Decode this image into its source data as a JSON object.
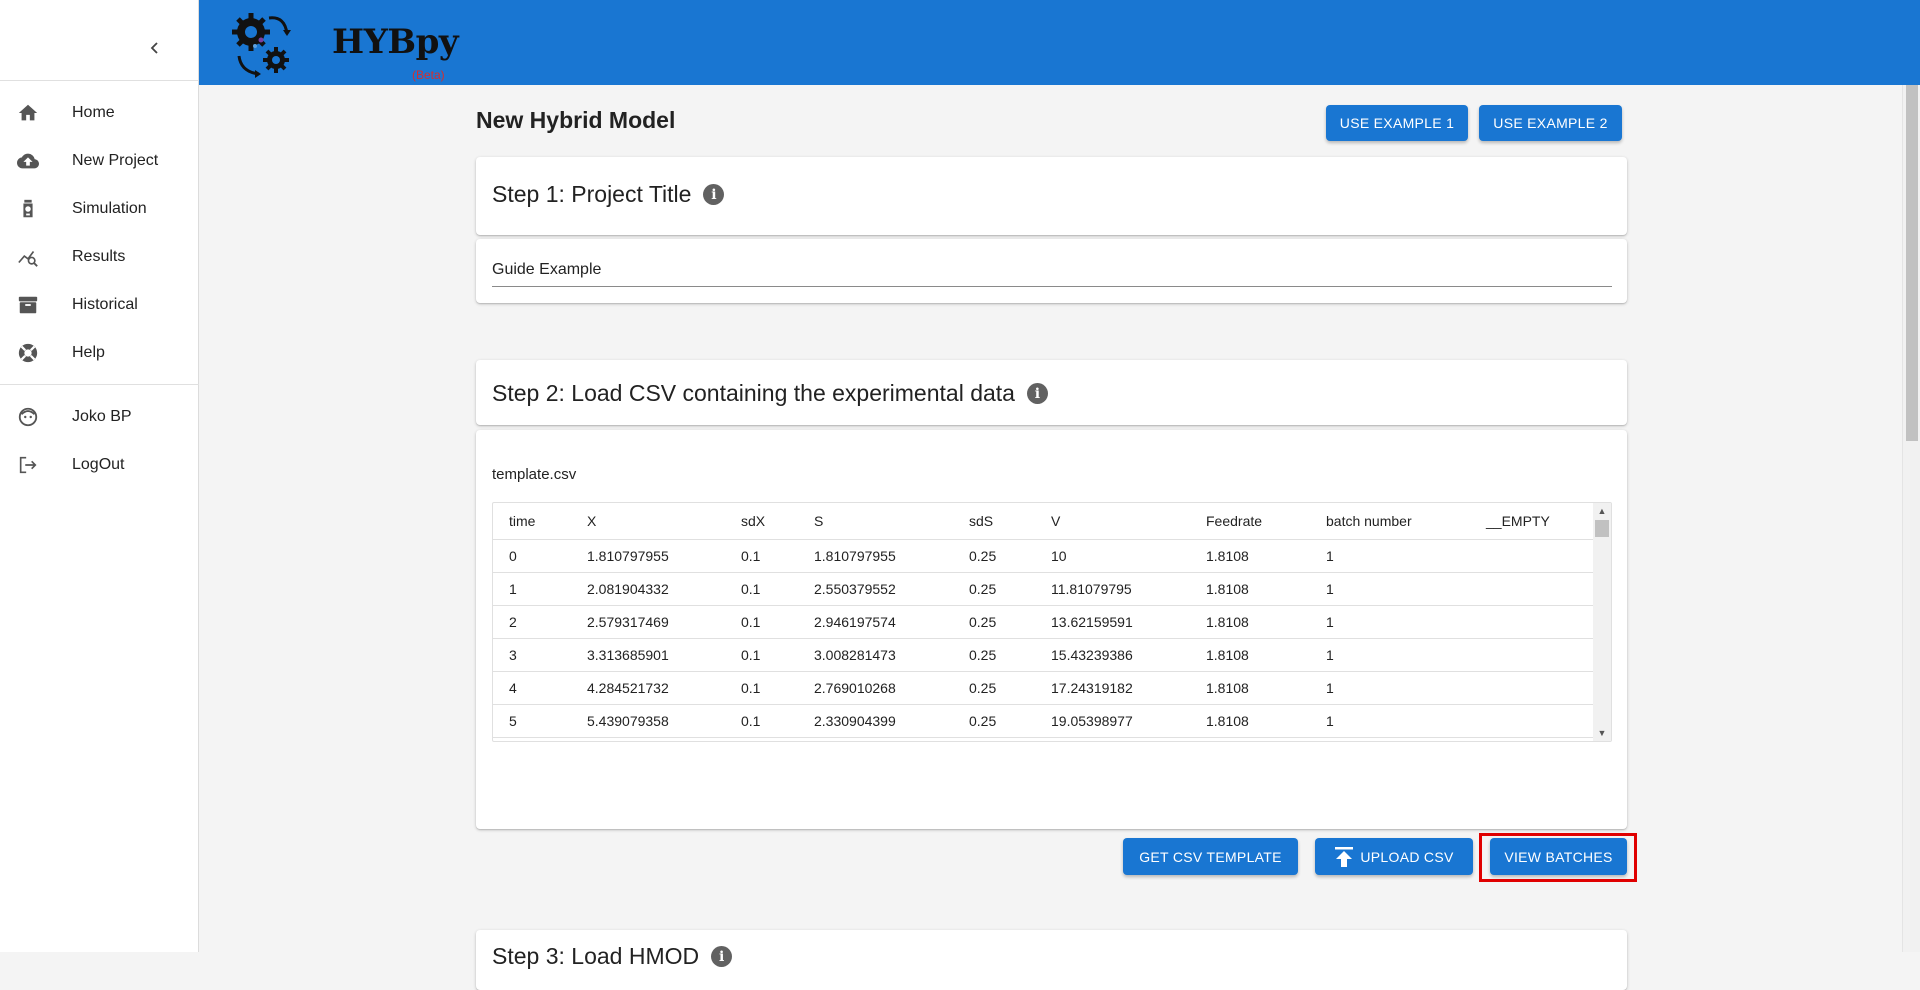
{
  "sidebar": {
    "collapse_icon": "chevron-left-icon",
    "items": [
      {
        "label": "Home",
        "icon": "home-icon"
      },
      {
        "label": "New Project",
        "icon": "cloud-upload-icon"
      },
      {
        "label": "Simulation",
        "icon": "simulation-icon"
      },
      {
        "label": "Results",
        "icon": "query-stats-icon"
      },
      {
        "label": "Historical",
        "icon": "archive-icon"
      },
      {
        "label": "Help",
        "icon": "lifebuoy-icon"
      }
    ],
    "user": {
      "label": "Joko BP",
      "icon": "face-icon"
    },
    "logout": {
      "label": "LogOut",
      "icon": "logout-icon"
    }
  },
  "header": {
    "logo_text": "HYBpy",
    "beta": "(Beta)",
    "color": "#1976d2"
  },
  "main": {
    "title": "New Hybrid Model",
    "example1": "USE EXAMPLE 1",
    "example2": "USE EXAMPLE 2",
    "step1": {
      "title": "Step 1: Project Title",
      "value": "Guide Example"
    },
    "step2": {
      "title": "Step 2: Load CSV containing the experimental data",
      "filename": "template.csv",
      "columns": [
        "time",
        "X",
        "sdX",
        "S",
        "sdS",
        "V",
        "Feedrate",
        "batch number",
        "__EMPTY"
      ],
      "rows": [
        [
          "0",
          "1.810797955",
          "0.1",
          "1.810797955",
          "0.25",
          "10",
          "1.8108",
          "1",
          ""
        ],
        [
          "1",
          "2.081904332",
          "0.1",
          "2.550379552",
          "0.25",
          "11.81079795",
          "1.8108",
          "1",
          ""
        ],
        [
          "2",
          "2.579317469",
          "0.1",
          "2.946197574",
          "0.25",
          "13.62159591",
          "1.8108",
          "1",
          ""
        ],
        [
          "3",
          "3.313685901",
          "0.1",
          "3.008281473",
          "0.25",
          "15.43239386",
          "1.8108",
          "1",
          ""
        ],
        [
          "4",
          "4.284521732",
          "0.1",
          "2.769010268",
          "0.25",
          "17.24319182",
          "1.8108",
          "1",
          ""
        ],
        [
          "5",
          "5.439079358",
          "0.1",
          "2.330904399",
          "0.25",
          "19.05398977",
          "1.8108",
          "1",
          ""
        ]
      ],
      "get_template": "GET CSV TEMPLATE",
      "upload": "UPLOAD CSV",
      "view_batches": "VIEW BATCHES"
    },
    "step3": {
      "title": "Step 3: Load HMOD"
    }
  }
}
